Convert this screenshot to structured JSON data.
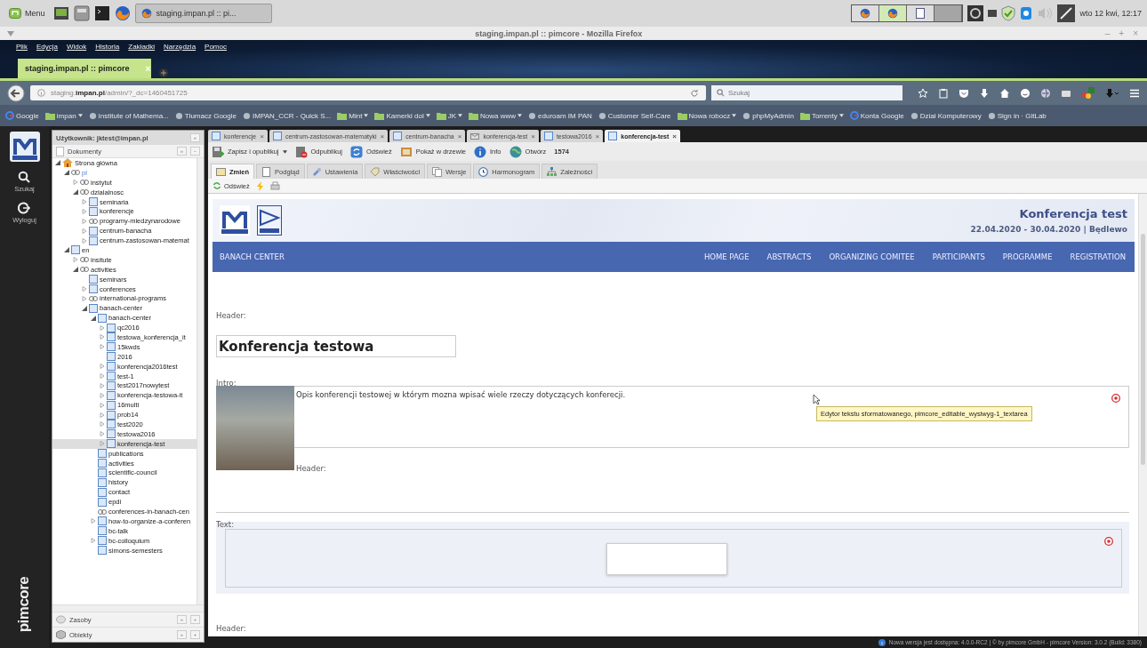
{
  "taskbar": {
    "menu_label": "Menu",
    "window_button": "staging.impan.pl :: pi...",
    "clock": "wto 12 kwi, 12:17"
  },
  "window": {
    "title": "staging.impan.pl :: pimcore - Mozilla Firefox",
    "controls": [
      "–",
      "+",
      "×"
    ]
  },
  "menu": [
    "Plik",
    "Edycja",
    "Widok",
    "Historia",
    "Zakładki",
    "Narzędzia",
    "Pomoc"
  ],
  "browser_tab": {
    "title": "staging.impan.pl :: pimcore",
    "close": "×"
  },
  "address_bar": {
    "url": "staging.**impan.pl**/admin/?_dc=1460451725"
  },
  "search": {
    "placeholder": "Szukaj"
  },
  "bookmarks": [
    {
      "label": "Google",
      "kind": "google"
    },
    {
      "label": "impan",
      "kind": "folder"
    },
    {
      "label": "Institute of Mathema...",
      "kind": "site"
    },
    {
      "label": "Tłumacz Google",
      "kind": "site"
    },
    {
      "label": "IMPAN_CCR - Quick S...",
      "kind": "site"
    },
    {
      "label": "Mint",
      "kind": "folder"
    },
    {
      "label": "Kamerki dol",
      "kind": "folder"
    },
    {
      "label": "JK",
      "kind": "folder"
    },
    {
      "label": "Nowa www",
      "kind": "folder"
    },
    {
      "label": "eduroam IM PAN",
      "kind": "site"
    },
    {
      "label": "Customer Self-Care",
      "kind": "site"
    },
    {
      "label": "Nowa robocz",
      "kind": "folder"
    },
    {
      "label": "phpMyAdmin",
      "kind": "site"
    },
    {
      "label": "Torrenty",
      "kind": "folder"
    },
    {
      "label": "Konta Google",
      "kind": "google"
    },
    {
      "label": "Dział Komputerowy",
      "kind": "site"
    },
    {
      "label": "Sign in · GitLab",
      "kind": "site"
    }
  ],
  "rail": {
    "items": [
      {
        "label": "Szukaj",
        "kind": "search"
      },
      {
        "label": "Wyloguj",
        "kind": "logout"
      }
    ],
    "brand": "pimcore"
  },
  "tree_panel": {
    "user": "Użytkownik: jktest@impan.pl",
    "collapse": "«",
    "section": "Dokumenty",
    "section_buttons": [
      "»",
      "−"
    ],
    "tree": [
      {
        "label": "Strona główna",
        "kind": "home",
        "expanded": true,
        "selected": false,
        "children": [
          {
            "label": "pl",
            "kind": "site",
            "expanded": true,
            "selected": false,
            "children": [
              {
                "label": "instytut",
                "kind": "link",
                "expanded": false,
                "selected": false
              },
              {
                "label": "dzialalnosc",
                "kind": "link",
                "expanded": true,
                "selected": false,
                "children": [
                  {
                    "label": "seminaria",
                    "kind": "page",
                    "expanded": false,
                    "selected": false
                  },
                  {
                    "label": "konferencje",
                    "kind": "page",
                    "expanded": false,
                    "selected": false
                  },
                  {
                    "label": "programy-miedzynarodowe",
                    "kind": "link",
                    "expanded": false,
                    "selected": false
                  },
                  {
                    "label": "centrum-banacha",
                    "kind": "page",
                    "expanded": false,
                    "selected": false
                  },
                  {
                    "label": "centrum-zastosowan-matemat",
                    "kind": "page",
                    "expanded": false,
                    "selected": false
                  }
                ]
              }
            ]
          },
          {
            "label": "en",
            "kind": "page",
            "expanded": true,
            "selected": false,
            "children": [
              {
                "label": "insitute",
                "kind": "link",
                "expanded": false,
                "selected": false
              },
              {
                "label": "activities",
                "kind": "link",
                "expanded": true,
                "selected": false,
                "children": [
                  {
                    "label": "seminars",
                    "kind": "page",
                    "selected": false
                  },
                  {
                    "label": "conferences",
                    "kind": "page",
                    "expanded": false,
                    "selected": false
                  },
                  {
                    "label": "international-programs",
                    "kind": "link",
                    "expanded": false,
                    "selected": false
                  },
                  {
                    "label": "banach-center",
                    "kind": "page",
                    "expanded": true,
                    "selected": false,
                    "children": [
                      {
                        "label": "banach-center",
                        "kind": "page",
                        "expanded": true,
                        "selected": false,
                        "children": [
                          {
                            "label": "qc2016",
                            "kind": "page",
                            "expanded": false,
                            "selected": false
                          },
                          {
                            "label": "testowa_konferencja_it",
                            "kind": "page",
                            "expanded": false,
                            "selected": false
                          },
                          {
                            "label": "15kwds",
                            "kind": "page",
                            "expanded": false,
                            "selected": false
                          },
                          {
                            "label": "2016",
                            "kind": "page",
                            "selected": false
                          },
                          {
                            "label": "konferencja2016test",
                            "kind": "page",
                            "expanded": false,
                            "selected": false
                          },
                          {
                            "label": "test-1",
                            "kind": "page",
                            "expanded": false,
                            "selected": false
                          },
                          {
                            "label": "test2017nowytest",
                            "kind": "page",
                            "expanded": false,
                            "selected": false
                          },
                          {
                            "label": "konferencja-testowa-it",
                            "kind": "page",
                            "expanded": false,
                            "selected": false
                          },
                          {
                            "label": "16multi",
                            "kind": "page",
                            "expanded": false,
                            "selected": false
                          },
                          {
                            "label": "prob14",
                            "kind": "page",
                            "expanded": false,
                            "selected": false
                          },
                          {
                            "label": "test2020",
                            "kind": "page",
                            "expanded": false,
                            "selected": false
                          },
                          {
                            "label": "testowa2016",
                            "kind": "page",
                            "expanded": false,
                            "selected": false
                          },
                          {
                            "label": "konferencja-test",
                            "kind": "page",
                            "expanded": false,
                            "selected": true
                          }
                        ]
                      },
                      {
                        "label": "publications",
                        "kind": "page",
                        "selected": false
                      },
                      {
                        "label": "activities",
                        "kind": "page",
                        "selected": false
                      },
                      {
                        "label": "scientific-council",
                        "kind": "page",
                        "selected": false
                      },
                      {
                        "label": "history",
                        "kind": "page",
                        "selected": false
                      },
                      {
                        "label": "contact",
                        "kind": "page",
                        "selected": false
                      },
                      {
                        "label": "epdi",
                        "kind": "page",
                        "selected": false
                      },
                      {
                        "label": "conferences-in-banach-cen",
                        "kind": "link",
                        "selected": false
                      },
                      {
                        "label": "how-to-organize-a-conferen",
                        "kind": "page",
                        "expanded": false,
                        "selected": false
                      },
                      {
                        "label": "bc-talk",
                        "kind": "page",
                        "selected": false
                      },
                      {
                        "label": "bc-colloquium",
                        "kind": "page",
                        "expanded": false,
                        "selected": false
                      },
                      {
                        "label": "simons-semesters",
                        "kind": "page",
                        "selected": false
                      }
                    ]
                  }
                ]
              }
            ]
          }
        ]
      }
    ],
    "bottom_sections": [
      {
        "label": "Zasoby",
        "kind": "assets",
        "buttons": [
          "»",
          "+"
        ]
      },
      {
        "label": "Obiekty",
        "kind": "objects",
        "buttons": [
          "»",
          "+"
        ]
      }
    ]
  },
  "doc_tabs": [
    {
      "label": "konferencje",
      "kind": "page",
      "selected": false,
      "close": "×"
    },
    {
      "label": "centrum-zastosowan-matematyki",
      "kind": "page",
      "selected": false,
      "close": "×"
    },
    {
      "label": "centrum-banacha",
      "kind": "page",
      "selected": false,
      "close": "×"
    },
    {
      "label": "konferencja-test",
      "kind": "email",
      "selected": false,
      "close": "×"
    },
    {
      "label": "testowa2016",
      "kind": "page",
      "selected": false,
      "close": "×"
    },
    {
      "label": "konferencja-test",
      "kind": "page",
      "selected": true,
      "close": "×"
    }
  ],
  "toolbar": [
    {
      "label": "Zapisz i opublikuj",
      "kind": "publish",
      "dropdown": true
    },
    {
      "label": "Odpublikuj",
      "kind": "unpublish"
    },
    {
      "label": "Odśwież",
      "kind": "refresh"
    },
    {
      "label": "Pokaż w drzewie",
      "kind": "tree"
    },
    {
      "label": "Info",
      "kind": "info"
    },
    {
      "label": "Otwórz",
      "kind": "open"
    },
    {
      "label": "1574",
      "kind": "id"
    }
  ],
  "subtabs": [
    {
      "label": "Zmień",
      "kind": "edit",
      "selected": true
    },
    {
      "label": "Podgląd",
      "kind": "preview",
      "selected": false
    },
    {
      "label": "Ustawienia",
      "kind": "settings",
      "selected": false
    },
    {
      "label": "Właściwości",
      "kind": "properties",
      "selected": false
    },
    {
      "label": "Wersje",
      "kind": "versions",
      "selected": false
    },
    {
      "label": "Harmonogram",
      "kind": "schedule",
      "selected": false
    },
    {
      "label": "Zależności",
      "kind": "dependencies",
      "selected": false
    }
  ],
  "toolbar2": [
    {
      "label": "Odśwież",
      "kind": "refresh"
    },
    {
      "kind": "lightning"
    },
    {
      "kind": "print"
    }
  ],
  "page": {
    "site_title": "Konferencja test",
    "site_dates": "22.04.2020 - 30.04.2020 | Będlewo",
    "brand": "BANACH CENTER",
    "nav": [
      "HOME PAGE",
      "ABSTRACTS",
      "ORGANIZING COMITEE",
      "PARTICIPANTS",
      "PROGRAMME",
      "REGISTRATION"
    ],
    "header_label": "Header:",
    "title_value": "Konferencja testowa",
    "intro_label": "Intro:",
    "intro_text": "Opis konferencji testowej w którym mozna wpisać wiele rzeczy dotyczących konferecji.",
    "tooltip": "Edytor tekstu sformatowanego, pimcore_editable_wysiwyg-1_textarea",
    "intro_header_label": "Header:",
    "text_label": "Text:",
    "footer_header_label": "Header:"
  },
  "status_bar": "Nowa wersja jest dostępna: 4.0.0-RC2 | © by pimcore GmbH - pimcore Version: 3.0.2 (Build: 3380)"
}
